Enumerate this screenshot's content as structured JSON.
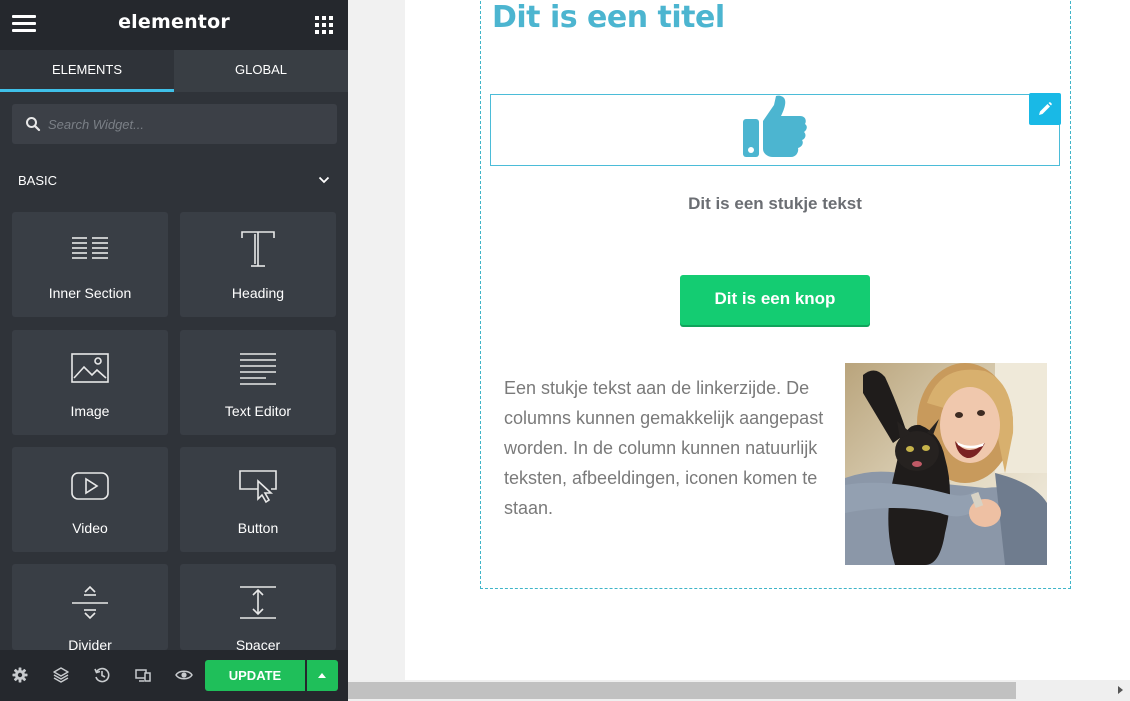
{
  "app": {
    "logo": "elementor"
  },
  "panel": {
    "tabs": [
      {
        "label": "ELEMENTS",
        "active": true
      },
      {
        "label": "GLOBAL",
        "active": false
      }
    ],
    "search": {
      "placeholder": "Search Widget..."
    },
    "category": {
      "label": "BASIC"
    },
    "widgets": [
      {
        "label": "Inner Section",
        "icon": "inner-section-icon"
      },
      {
        "label": "Heading",
        "icon": "heading-icon"
      },
      {
        "label": "Image",
        "icon": "image-icon"
      },
      {
        "label": "Text Editor",
        "icon": "text-editor-icon"
      },
      {
        "label": "Video",
        "icon": "video-icon"
      },
      {
        "label": "Button",
        "icon": "button-icon"
      },
      {
        "label": "Divider",
        "icon": "divider-icon"
      },
      {
        "label": "Spacer",
        "icon": "spacer-icon"
      }
    ],
    "footer": {
      "icons": [
        "settings-icon",
        "navigator-layers-icon",
        "history-icon",
        "responsive-mode-icon",
        "preview-eye-icon"
      ],
      "update_label": "UPDATE"
    }
  },
  "preview": {
    "heading": "Dit is een titel",
    "text": "Dit is een stukje tekst",
    "button_label": "Dit is een knop",
    "column_text": "Een stukje tekst aan de linkerzijde. De columns kunnen gemakkelijk aangepast worden. In de column kunnen natuurlijk teksten, afbeeldingen, iconen komen te staan.",
    "icon": "thumbs-up-icon"
  },
  "colors": {
    "panel_bg": "#2f3339",
    "accent": "#3fc0e8",
    "update_green": "#1fbf5a",
    "heading_blue": "#4cb5d0",
    "cta_green": "#14cc72"
  }
}
